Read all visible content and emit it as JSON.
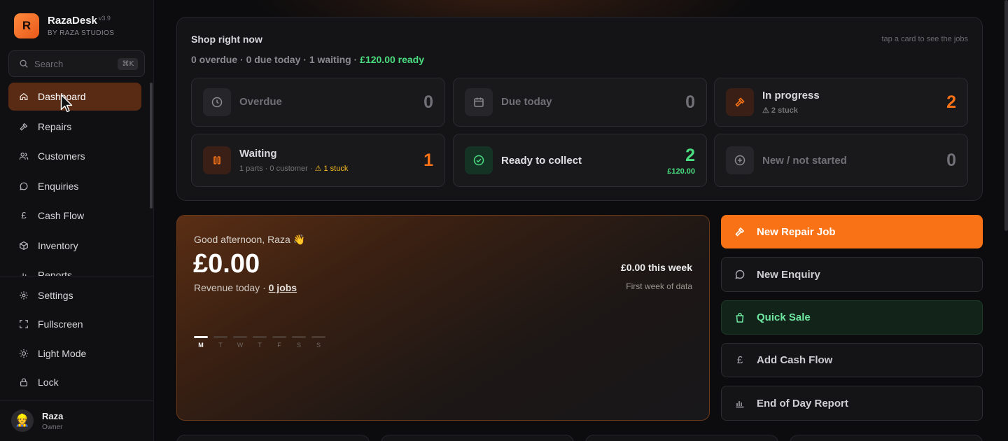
{
  "brand": {
    "logo_letter": "R",
    "name": "RazaDesk",
    "version": "v3.9",
    "subtitle": "BY RAZA STUDIOS"
  },
  "search": {
    "placeholder": "Search",
    "shortcut": "⌘K"
  },
  "nav": {
    "items": [
      {
        "label": "Dashboard",
        "icon": "home-icon",
        "active": true
      },
      {
        "label": "Repairs",
        "icon": "hammer-icon"
      },
      {
        "label": "Customers",
        "icon": "users-icon"
      },
      {
        "label": "Enquiries",
        "icon": "message-icon"
      },
      {
        "label": "Cash Flow",
        "icon": "pound-icon"
      },
      {
        "label": "Inventory",
        "icon": "box-icon"
      },
      {
        "label": "Reports",
        "icon": "chart-icon"
      }
    ]
  },
  "lower_nav": {
    "items": [
      {
        "label": "Settings",
        "icon": "gear-icon"
      },
      {
        "label": "Fullscreen",
        "icon": "fullscreen-icon"
      },
      {
        "label": "Light Mode",
        "icon": "sun-icon"
      },
      {
        "label": "Lock",
        "icon": "lock-icon"
      }
    ]
  },
  "user": {
    "name": "Raza",
    "role": "Owner",
    "avatar": "👷"
  },
  "shop": {
    "title": "Shop right now",
    "hint": "tap a card to see the jobs",
    "summary": "0 overdue · 0 due today · 1 waiting · ",
    "summary_ready": "£120.00 ready",
    "cards": {
      "overdue": {
        "label": "Overdue",
        "count": "0"
      },
      "due_today": {
        "label": "Due today",
        "count": "0"
      },
      "in_progress": {
        "label": "In progress",
        "sub": "⚠ 2 stuck",
        "count": "2"
      },
      "waiting": {
        "label": "Waiting",
        "sub": "1 parts · 0 customer · ",
        "sub_warn": "⚠ 1 stuck",
        "count": "1"
      },
      "ready": {
        "label": "Ready to collect",
        "count": "2",
        "amount": "£120.00"
      },
      "new": {
        "label": "New / not started",
        "count": "0"
      }
    }
  },
  "hero": {
    "greeting": "Good afternoon, Raza 👋",
    "revenue": "£0.00",
    "revenue_label": "Revenue today · ",
    "jobs_link": "0 jobs",
    "week_total": "£0.00 this week",
    "week_note": "First week of data",
    "days": [
      "M",
      "T",
      "W",
      "T",
      "F",
      "S",
      "S"
    ],
    "active_day": 0
  },
  "actions": {
    "new_repair": "New Repair Job",
    "new_enquiry": "New Enquiry",
    "quick_sale": "Quick Sale",
    "add_cash_flow": "Add Cash Flow",
    "end_of_day": "End of Day Report"
  },
  "colors": {
    "accent": "#f97316",
    "success": "#4ade80",
    "warning": "#fbbf24",
    "background": "#0c0c0e"
  }
}
